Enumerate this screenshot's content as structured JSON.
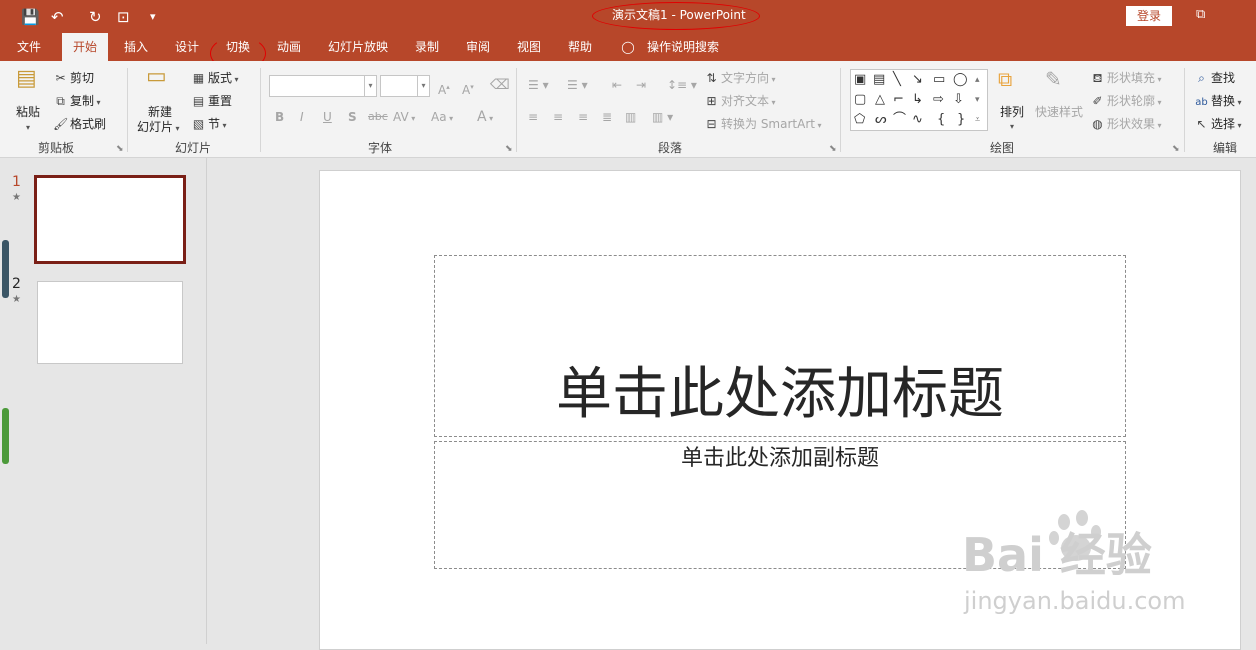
{
  "quick_access": {
    "save_icon": "💾",
    "undo_icon": "↶",
    "redo_icon": "↻",
    "present_icon": "⊡",
    "more_icon": "▾"
  },
  "window": {
    "title": "演示文稿1  -  PowerPoint",
    "login_label": "登录",
    "restore_icon": "⧉"
  },
  "tabs": [
    {
      "label": "文件"
    },
    {
      "label": "开始"
    },
    {
      "label": "插入"
    },
    {
      "label": "设计"
    },
    {
      "label": "切换"
    },
    {
      "label": "动画"
    },
    {
      "label": "幻灯片放映"
    },
    {
      "label": "录制"
    },
    {
      "label": "审阅"
    },
    {
      "label": "视图"
    },
    {
      "label": "帮助"
    },
    {
      "label": "操作说明搜索"
    }
  ],
  "ribbon": {
    "clipboard": {
      "paste": "粘贴",
      "cut": "剪切",
      "copy": "复制",
      "format_painter": "格式刷",
      "label": "剪贴板"
    },
    "slides": {
      "new_slide_line1": "新建",
      "new_slide_line2": "幻灯片",
      "layout": "版式",
      "reset": "重置",
      "section": "节",
      "label": "幻灯片"
    },
    "font": {
      "label": "字体",
      "bold": "B",
      "italic": "I",
      "underline": "U",
      "shadow": "S",
      "strike": "abc",
      "spacing": "AV",
      "case": "Aa",
      "color": "A"
    },
    "paragraph": {
      "label": "段落",
      "text_direction": "文字方向",
      "align_text": "对齐文本",
      "convert_smartart": "转换为 SmartArt"
    },
    "drawing": {
      "label": "绘图",
      "arrange": "排列",
      "quick_styles": "快速样式",
      "shape_fill": "形状填充",
      "shape_outline": "形状轮廓",
      "shape_effects": "形状效果"
    },
    "editing": {
      "label": "编辑",
      "find": "查找",
      "replace": "替换",
      "select": "选择"
    }
  },
  "thumbnails": [
    {
      "number": "1",
      "star": "★"
    },
    {
      "number": "2",
      "star": "★"
    }
  ],
  "slide": {
    "title_placeholder": "单击此处添加标题",
    "subtitle_placeholder": "单击此处添加副标题"
  },
  "watermark": {
    "logo": "Bai 经验",
    "url": "jingyan.baidu.com"
  },
  "colors": {
    "accent": "#b7472a",
    "ribbon": "#f3f3f3",
    "annotation": "#e00000"
  }
}
